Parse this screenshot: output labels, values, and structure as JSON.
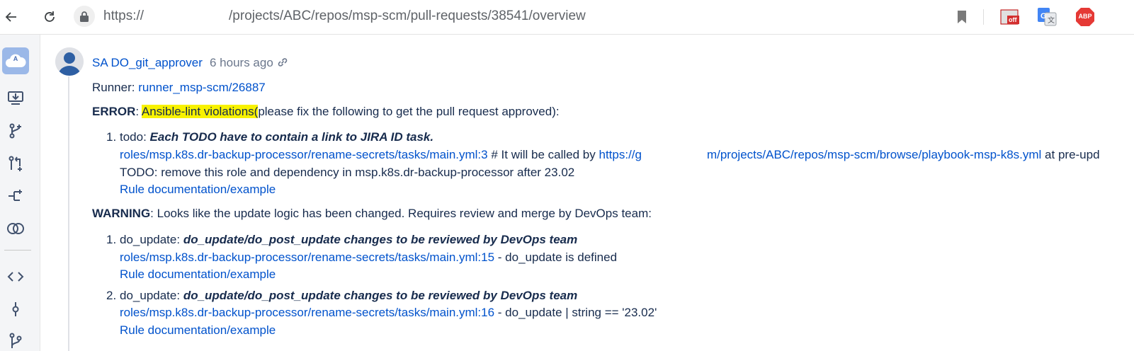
{
  "browser": {
    "url_prefix": "https://",
    "url_path": "/projects/ABC/repos/msp-scm/pull-requests/38541/overview",
    "ext_off_label": "off",
    "ext_abp_label": "ABP"
  },
  "sidebar": {
    "project_letter": "A"
  },
  "comment": {
    "author": "SA DO_git_approver",
    "time": "6 hours ago",
    "runner_label": "Runner: ",
    "runner_link": "runner_msp-scm/26887",
    "error_label": "ERROR",
    "error_sep": ": ",
    "error_highlight": "Ansible-lint violations(",
    "error_rest": "please fix the following to get the pull request approved):",
    "errors": [
      {
        "num": "1.",
        "tag": "todo: ",
        "title": "Each TODO have to contain a link to JIRA ID task.",
        "path": "roles/msp.k8s.dr-backup-processor/rename-secrets/tasks/main.yml:3",
        "desc": " # It will be called by ",
        "url_start": "https://g",
        "url_end": "m/projects/ABC/repos/msp-scm/browse/playbook-msp-k8s.yml",
        "tail": " at pre-upd",
        "line2": "TODO: remove this role and dependency in msp.k8s.dr-backup-processor after 23.02",
        "rule": "Rule documentation/example"
      }
    ],
    "warning_label": "WARNING",
    "warning_rest": ": Looks like the update logic has been changed. Requires review and merge by DevOps team:",
    "warnings": [
      {
        "num": "1.",
        "tag": "do_update: ",
        "title": "do_update/do_post_update changes to be reviewed by DevOps team",
        "path": "roles/msp.k8s.dr-backup-processor/rename-secrets/tasks/main.yml:15",
        "desc": " - do_update is defined",
        "rule": "Rule documentation/example"
      },
      {
        "num": "2.",
        "tag": "do_update: ",
        "title": "do_update/do_post_update changes to be reviewed by DevOps team",
        "path": "roles/msp.k8s.dr-backup-processor/rename-secrets/tasks/main.yml:16",
        "desc": " - do_update | string == '23.02'",
        "rule": "Rule documentation/example"
      }
    ]
  }
}
